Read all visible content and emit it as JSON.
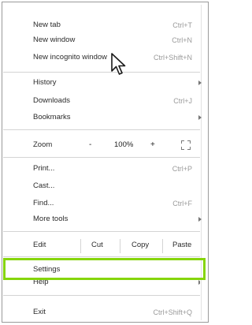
{
  "menu": {
    "group1": [
      {
        "label": "New tab",
        "shortcut": "Ctrl+T"
      },
      {
        "label": "New window",
        "shortcut": "Ctrl+N"
      },
      {
        "label": "New incognito window",
        "shortcut": "Ctrl+Shift+N"
      }
    ],
    "group2": [
      {
        "label": "History"
      },
      {
        "label": "Downloads",
        "shortcut": "Ctrl+J"
      },
      {
        "label": "Bookmarks"
      }
    ],
    "zoom": {
      "label": "Zoom",
      "minus": "-",
      "value": "100%",
      "plus": "+"
    },
    "group3": [
      {
        "label": "Print...",
        "shortcut": "Ctrl+P"
      },
      {
        "label": "Cast..."
      },
      {
        "label": "Find...",
        "shortcut": "Ctrl+F"
      },
      {
        "label": "More tools"
      }
    ],
    "edit": {
      "label": "Edit",
      "cut": "Cut",
      "copy": "Copy",
      "paste": "Paste"
    },
    "group4": [
      {
        "label": "Settings"
      },
      {
        "label": "Help"
      }
    ],
    "exit": {
      "label": "Exit",
      "shortcut": "Ctrl+Shift+Q"
    }
  },
  "highlight_color": "#86d50c"
}
